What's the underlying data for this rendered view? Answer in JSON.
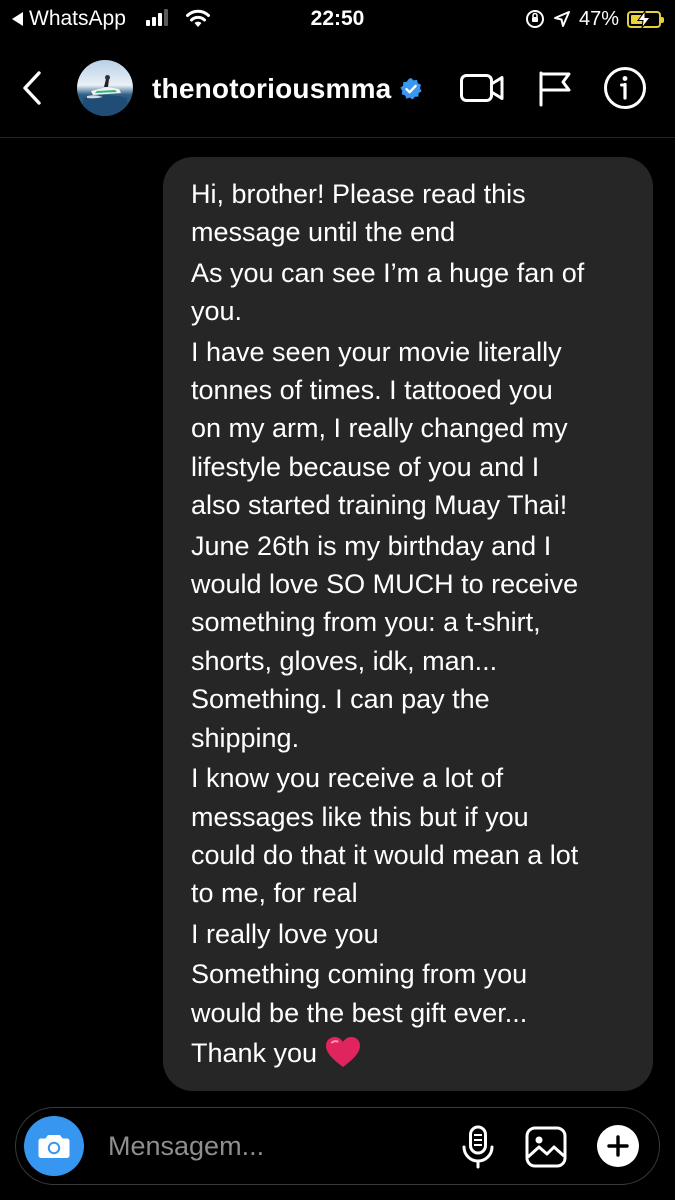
{
  "status_bar": {
    "back_app": "WhatsApp",
    "time": "22:50",
    "battery": "47%",
    "battery_level": 0.47,
    "signal_bars": 3,
    "signal_bars_total": 4
  },
  "header": {
    "username": "thenotoriousmma",
    "verified": true,
    "icons": [
      "back-icon",
      "avatar",
      "verified-badge-icon",
      "video-call-icon",
      "flag-icon",
      "info-icon"
    ]
  },
  "message": {
    "paragraphs": [
      {
        "lines": [
          "Hi, brother! Please read this",
          "message until the end"
        ]
      },
      {
        "lines": [
          "As you can see I’m a huge fan of",
          "you."
        ]
      },
      {
        "lines": [
          "I have seen your movie literally",
          "tonnes of times. I tattooed you",
          "on my arm, I really changed my",
          "lifestyle because of you and I",
          "also started training Muay Thai!"
        ]
      },
      {
        "lines": [
          "June 26th is my birthday and I",
          "would love SO MUCH to receive",
          "something from you: a t-shirt,",
          "shorts, gloves, idk, man...",
          "Something. I can pay the",
          "shipping."
        ]
      },
      {
        "lines": [
          "I know you receive a lot of",
          "messages like this but if you",
          "could do that it would mean a lot",
          "to me, for real"
        ]
      },
      {
        "lines": [
          "I really love you"
        ]
      },
      {
        "lines": [
          "Something coming from you",
          "would be the best gift ever..."
        ]
      },
      {
        "lines": [
          "Thank you"
        ],
        "emoji": "heart-emoji"
      }
    ]
  },
  "composer": {
    "placeholder": "Mensagem...",
    "value": "",
    "icons": [
      "camera-icon",
      "microphone-icon",
      "gallery-icon",
      "add-icon"
    ]
  },
  "colors": {
    "background": "#000000",
    "bubble": "#262626",
    "accent_blue": "#3797f0",
    "verified_blue": "#3897f0",
    "battery_yellow": "#e8d43a",
    "heart_red": "#e0245e",
    "placeholder_gray": "#8e8e8e"
  }
}
